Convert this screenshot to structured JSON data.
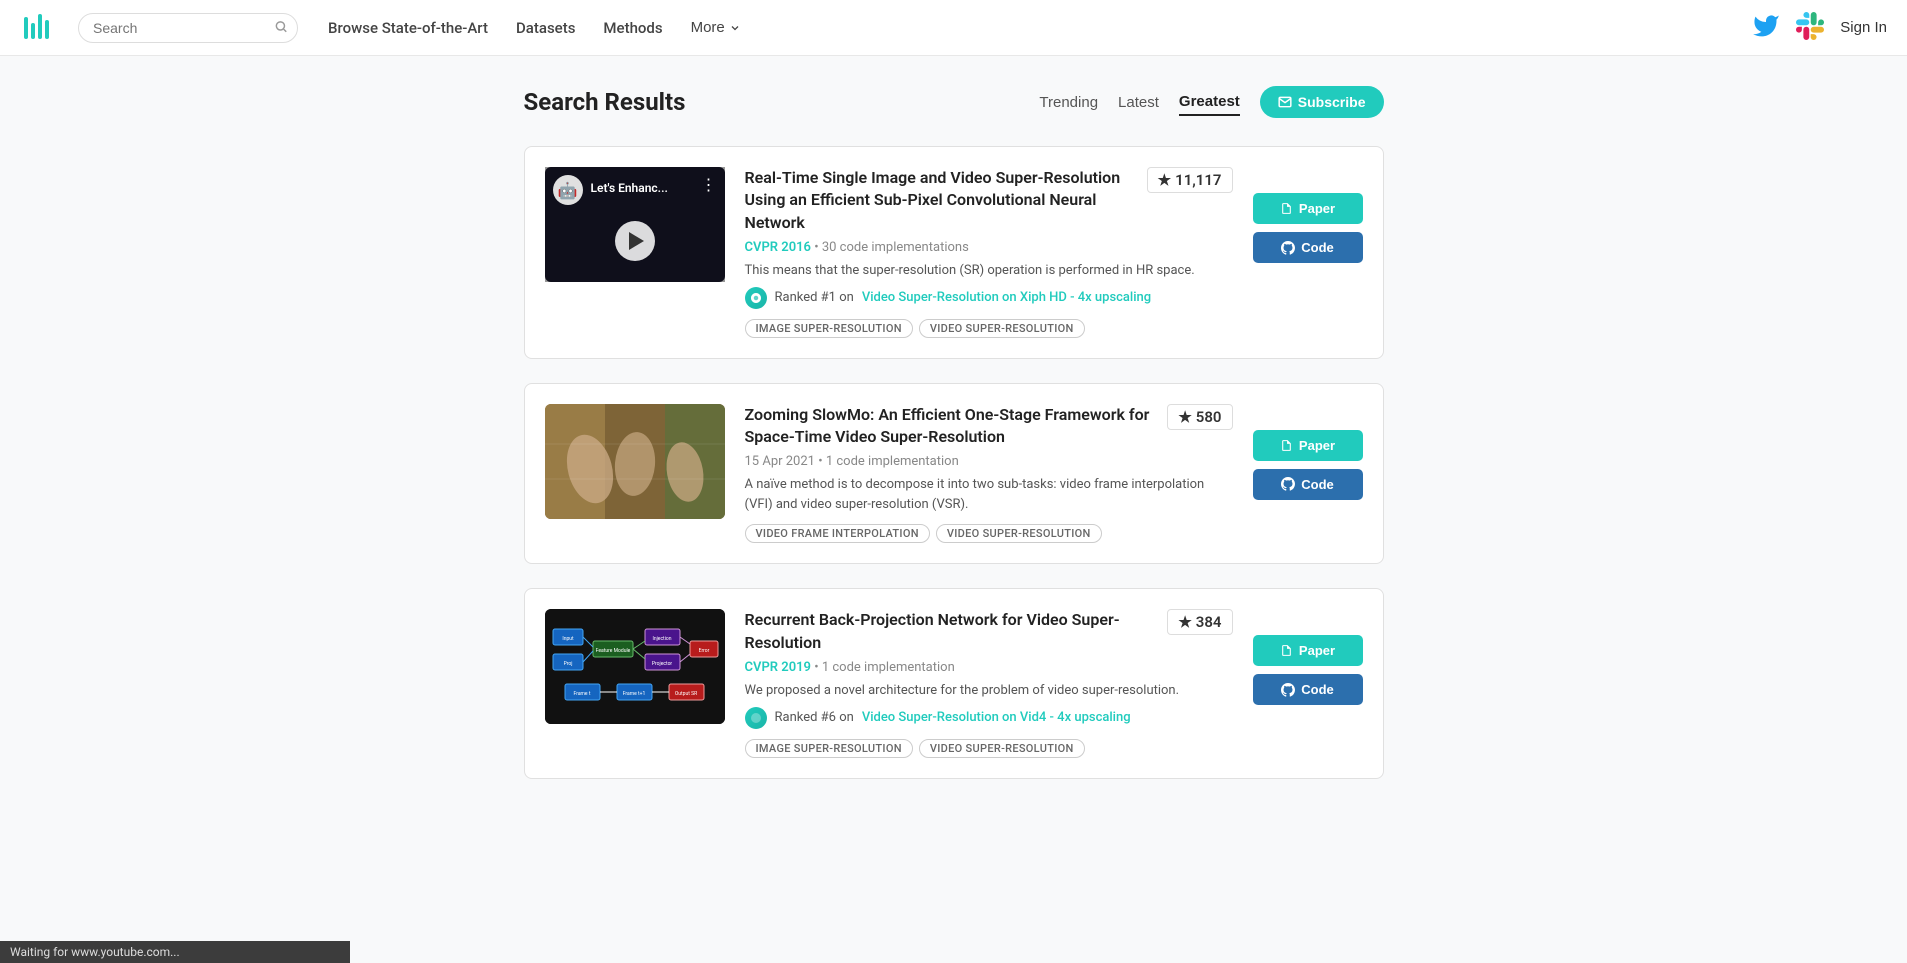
{
  "navbar": {
    "logo_alt": "Papers with Code",
    "search_placeholder": "Search",
    "links": [
      {
        "label": "Browse State-of-the-Art",
        "href": "#"
      },
      {
        "label": "Datasets",
        "href": "#"
      },
      {
        "label": "Methods",
        "href": "#"
      }
    ],
    "more_label": "More",
    "twitter_title": "Twitter",
    "slack_title": "Slack",
    "signin_label": "Sign In"
  },
  "page": {
    "title": "Search Results",
    "filter_tabs": [
      {
        "label": "Trending",
        "active": false
      },
      {
        "label": "Latest",
        "active": false
      },
      {
        "label": "Greatest",
        "active": true
      }
    ],
    "subscribe_label": "Subscribe"
  },
  "results": [
    {
      "id": "result-1",
      "title": "Real-Time Single Image and Video Super-Resolution Using an Efficient Sub-Pixel Convolutional Neural Network",
      "venue": "CVPR 2016",
      "venue_href": "#",
      "meta": "30 code implementations",
      "stars": "11,117",
      "description": "This means that the super-resolution (SR) operation is performed in HR space.",
      "rank_text": "Ranked #1 on",
      "rank_link": "Video Super-Resolution on Xiph HD - 4x upscaling",
      "rank_href": "#",
      "tags": [
        "IMAGE SUPER-RESOLUTION",
        "VIDEO SUPER-RESOLUTION"
      ],
      "thumb_type": "video",
      "thumb_label": "Let's Enhanc...",
      "paper_btn": "Paper",
      "code_btn": "Code"
    },
    {
      "id": "result-2",
      "title": "Zooming SlowMo: An Efficient One-Stage Framework for Space-Time Video Super-Resolution",
      "date": "15 Apr 2021",
      "meta": "1 code implementation",
      "stars": "580",
      "description": "A naïve method is to decompose it into two sub-tasks: video frame interpolation (VFI) and video super-resolution (VSR).",
      "rank_text": "",
      "rank_link": "",
      "rank_href": "",
      "tags": [
        "VIDEO FRAME INTERPOLATION",
        "VIDEO SUPER-RESOLUTION"
      ],
      "thumb_type": "hands",
      "paper_btn": "Paper",
      "code_btn": "Code"
    },
    {
      "id": "result-3",
      "title": "Recurrent Back-Projection Network for Video Super-Resolution",
      "venue": "CVPR 2019",
      "venue_href": "#",
      "meta": "1 code implementation",
      "stars": "384",
      "description": "We proposed a novel architecture for the problem of video super-resolution.",
      "rank_text": "Ranked #6 on",
      "rank_link": "Video Super-Resolution on Vid4 - 4x upscaling",
      "rank_href": "#",
      "tags": [
        "IMAGE SUPER-RESOLUTION",
        "VIDEO SUPER-RESOLUTION"
      ],
      "thumb_type": "diagram",
      "paper_btn": "Paper",
      "code_btn": "Code"
    }
  ],
  "status_bar": {
    "text": "Waiting for www.youtube.com..."
  }
}
